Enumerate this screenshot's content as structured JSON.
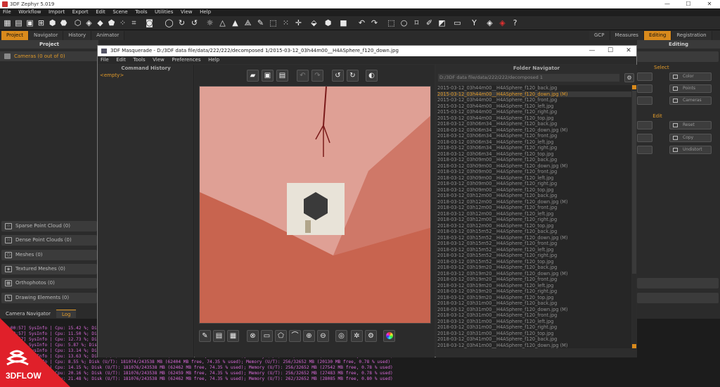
{
  "app": {
    "title": "3DF Zephyr 5.019",
    "window_controls": [
      "—",
      "☐",
      "✕"
    ]
  },
  "menubar": [
    "File",
    "Workflow",
    "Import",
    "Export",
    "Edit",
    "Scene",
    "Tools",
    "Utilities",
    "View",
    "Help"
  ],
  "left_tabs": [
    {
      "label": "Project",
      "active": true
    },
    {
      "label": "Navigator",
      "active": false
    },
    {
      "label": "History",
      "active": false
    },
    {
      "label": "Animator",
      "active": false
    }
  ],
  "left_panel": {
    "header": "Project",
    "cameras": "Cameras (0 out of 0)",
    "rows": [
      "Sparse Point Cloud (0)",
      "Dense Point Clouds (0)",
      "Meshes (0)",
      "Textured Meshes (0)",
      "Orthophotos (0)",
      "Drawing Elements (0)"
    ]
  },
  "right_tabs": [
    {
      "label": "GCP",
      "active": false
    },
    {
      "label": "Measures",
      "active": false
    },
    {
      "label": "Editing",
      "active": true
    },
    {
      "label": "Registration",
      "active": false
    }
  ],
  "right_panel": {
    "header": "Editing",
    "select_label": "Select",
    "edit_label": "Edit",
    "select_buttons": [
      "Color",
      "Points",
      "Cameras"
    ],
    "edit_buttons": [
      "Reset",
      "Copy",
      "Undistort"
    ]
  },
  "bottom_tabs": [
    {
      "label": "Camera Navigator",
      "active": false
    },
    {
      "label": "Log",
      "active": true
    }
  ],
  "log_lines": [
    "[08:00:57] SysInfo | Cpu: 15.42 %; Disk (U/T): 181074/243538 MB (62404 MB free, 74.35 % used); Memory (U/T): 256/32652 MB (20130 MB free, 0.78 % used)",
    "[08:00:57] SysInfo | Cpu: 11.50 %; Disk (U/T): 181074/243538 MB (62404 MB free, 74.35 % used); Memory (U/T): 256/32652 MB (20130 MB free, 0.78 % used)",
    "[08:00:57] SysInfo | Cpu: 12.73 %; Disk (U/T): 181074/243538 MB (62404 MB free, 74.35 % used); Memory (U/T): 256/32652 MB (20130 MB free, 0.78 % used)",
    "[08:00:57] SysInfo | Cpu: 5.87 %; Disk (U/T): 181074/243538 MB (62404 MB free, 74.35 % used); Memory (U/T): 256/32652 MB (20130 MB free, 0.78 % used)",
    "[08:00:57] SysInfo | Cpu: 13.14 %; Disk (U/T): 181074/243538 MB (62404 MB free, 74.35 % used); Memory (U/T): 256/32652 MB (20130 MB free, 0.78 % used)",
    "[08:00:57] SysInfo | Cpu: 13.63 %; Disk (U/T): 181074/243538 MB (62404 MB free, 74.35 % used); Memory (U/T): 256/32652 MB (20130 MB free, 0.78 % used)",
    "[08:00:57] SysInfo | Cpu: 8.55 %; Disk (U/T): 181074/243538 MB (62404 MB free, 74.35 % used); Memory (U/T): 256/32652 MB (20130 MB free, 0.78 % used)",
    "[08:00:57] SysInfo | Cpu: 14.15 %; Disk (U/T): 181076/243538 MB (62462 MB free, 74.35 % used); Memory (U/T): 256/32652 MB (27542 MB free, 0.78 % used)",
    "[08:00:57] SysInfo | Cpu: 20.16 %; Disk (U/T): 181076/243538 MB (62459 MB free, 74.35 % used); Memory (U/T): 256/32652 MB (27483 MB free, 0.78 % used)",
    "[08:00:57] SysInfo | Cpu: 21.48 %; Disk (U/T): 181076/243538 MB (62462 MB free, 74.35 % used); Memory (U/T): 262/32652 MB (28085 MB free, 0.80 % used)"
  ],
  "logo": {
    "text": "3DFLOW",
    "color": "#e0202a"
  },
  "dialog": {
    "title": "3DF Masquerade - D:/3DF data file/data/222/222/decomposed 1/2015-03-12_03h44m00__H4ASphere_f120_down.jpg",
    "menu": [
      "File",
      "Edit",
      "Tools",
      "View",
      "Preferences",
      "Help"
    ],
    "command_history_title": "Command History",
    "command_history_empty": "<empty>",
    "folder_navigator_title": "Folder Navigator",
    "folder_path": "D:/3DF data file/data/222/222/decomposed 1",
    "files": [
      "2015-03-12_03h44m00__H4ASphere_f120_back.jpg",
      "2015-03-12_03h44m00__H4ASphere_f120_down.jpg (M)",
      "2015-03-12_03h44m00__H4ASphere_f120_front.jpg",
      "2015-03-12_03h44m00__H4ASphere_f120_left.jpg",
      "2015-03-12_03h44m00__H4ASphere_f120_right.jpg",
      "2015-03-12_03h44m00__H4ASphere_f120_top.jpg",
      "2018-03-12_03h06m34__H4ASphere_f120_back.jpg",
      "2018-03-12_03h06m34__H4ASphere_f120_down.jpg (M)",
      "2018-03-12_03h06m34__H4ASphere_f120_front.jpg",
      "2018-03-12_03h06m34__H4ASphere_f120_left.jpg",
      "2018-03-12_03h06m34__H4ASphere_f120_right.jpg",
      "2018-03-12_03h06m34__H4ASphere_f120_top.jpg",
      "2018-03-12_03h09m00__H4ASphere_f120_back.jpg",
      "2018-03-12_03h09m00__H4ASphere_f120_down.jpg (M)",
      "2018-03-12_03h09m00__H4ASphere_f120_front.jpg",
      "2018-03-12_03h09m00__H4ASphere_f120_left.jpg",
      "2018-03-12_03h09m00__H4ASphere_f120_right.jpg",
      "2018-03-12_03h09m00__H4ASphere_f120_top.jpg",
      "2018-03-12_03h12m00__H4ASphere_f120_back.jpg",
      "2018-03-12_03h12m00__H4ASphere_f120_down.jpg (M)",
      "2018-03-12_03h12m00__H4ASphere_f120_front.jpg",
      "2018-03-12_03h12m00__H4ASphere_f120_left.jpg",
      "2018-03-12_03h12m00__H4ASphere_f120_right.jpg",
      "2018-03-12_03h12m00__H4ASphere_f120_top.jpg",
      "2018-03-12_03h15m52__H4ASphere_f120_back.jpg",
      "2018-03-12_03h15m52__H4ASphere_f120_down.jpg (M)",
      "2018-03-12_03h15m52__H4ASphere_f120_front.jpg",
      "2018-03-12_03h15m52__H4ASphere_f120_left.jpg",
      "2018-03-12_03h15m52__H4ASphere_f120_right.jpg",
      "2018-03-12_03h15m52__H4ASphere_f120_top.jpg",
      "2018-03-12_03h19m20__H4ASphere_f120_back.jpg",
      "2018-03-12_03h19m20__H4ASphere_f120_down.jpg (M)",
      "2018-03-12_03h19m20__H4ASphere_f120_front.jpg",
      "2018-03-12_03h19m20__H4ASphere_f120_left.jpg",
      "2018-03-12_03h19m20__H4ASphere_f120_right.jpg",
      "2018-03-12_03h19m20__H4ASphere_f120_top.jpg",
      "2018-03-12_03h31m00__H4ASphere_f120_back.jpg",
      "2018-03-12_03h31m00__H4ASphere_f120_down.jpg (M)",
      "2018-03-12_03h31m00__H4ASphere_f120_front.jpg",
      "2018-03-12_03h31m00__H4ASphere_f120_left.jpg",
      "2018-03-12_03h31m00__H4ASphere_f120_right.jpg",
      "2018-03-12_03h31m00__H4ASphere_f120_top.jpg",
      "2018-03-12_03h41m00__H4ASphere_f120_back.jpg",
      "2018-03-12_03h41m00__H4ASphere_f120_down.jpg (M)"
    ],
    "selected_file_index": 1
  }
}
